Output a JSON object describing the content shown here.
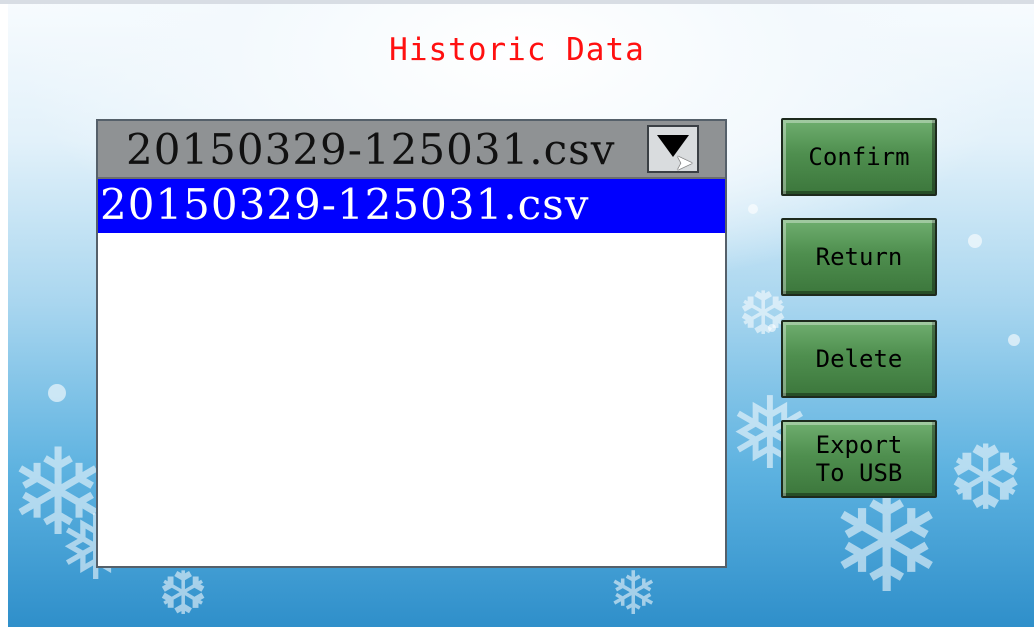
{
  "page": {
    "title": "Historic Data"
  },
  "file_select": {
    "selected_value": "20150329-125031.csv",
    "items": [
      {
        "label": "20150329-125031.csv",
        "selected": true
      }
    ]
  },
  "buttons": {
    "confirm": "Confirm",
    "return": "Return",
    "delete": "Delete",
    "export": "Export\nTo USB"
  },
  "colors": {
    "title": "#ff1010",
    "selection": "#0000ff",
    "button": "#4f8f4f",
    "combo_header": "#8f9294"
  },
  "icons": {
    "dropdown": "chevron-down-icon",
    "cursor": "mouse-pointer-icon"
  }
}
